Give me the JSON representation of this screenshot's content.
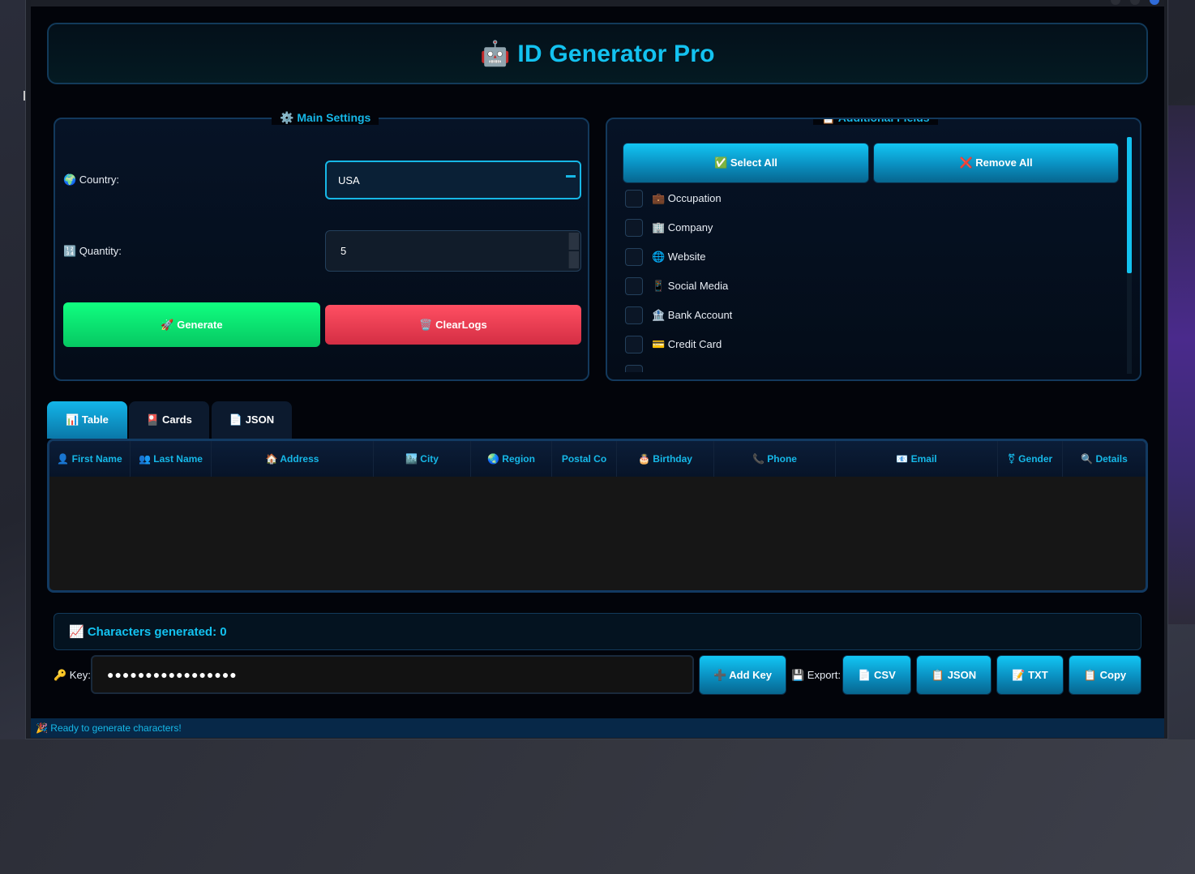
{
  "header": {
    "title": "🤖 ID Generator Pro"
  },
  "main_settings": {
    "legend": "⚙️ Main Settings",
    "country_label": "🌍 Country:",
    "country_value": "USA",
    "quantity_label": "🔢 Quantity:",
    "quantity_value": "5",
    "generate_label": "🚀 Generate",
    "clear_label": "🗑️ ClearLogs"
  },
  "additional_fields": {
    "legend": "📋 Additional Fields",
    "select_all_label": "✅ Select All",
    "remove_all_label": "❌ Remove All",
    "items": [
      {
        "label": "💼 Occupation",
        "checked": false
      },
      {
        "label": "🏢 Company",
        "checked": false
      },
      {
        "label": "🌐 Website",
        "checked": false
      },
      {
        "label": "📱 Social Media",
        "checked": false
      },
      {
        "label": "🏦 Bank Account",
        "checked": false
      },
      {
        "label": "💳 Credit Card",
        "checked": false
      }
    ]
  },
  "tabs": [
    {
      "label": "📊 Table",
      "active": true
    },
    {
      "label": "🎴 Cards",
      "active": false
    },
    {
      "label": "📄 JSON",
      "active": false
    }
  ],
  "table": {
    "columns": [
      "👤 First Name",
      "👥 Last Name",
      "🏠 Address",
      "🏙️ City",
      "🌏 Region",
      "Postal Co",
      "🎂 Birthday",
      "📞 Phone",
      "📧 Email",
      "⚧ Gender",
      "🔍 Details"
    ],
    "rows": []
  },
  "stats": {
    "text": "📈 Characters generated: 0"
  },
  "footer": {
    "key_label": "🔑 Key:",
    "key_value": "●●●●●●●●●●●●●●●●●",
    "add_key_label": "➕ Add Key",
    "export_label": "💾 Export:",
    "csv_label": "📄 CSV",
    "json_label": "📋 JSON",
    "txt_label": "📝 TXT",
    "copy_label": "📋 Copy"
  },
  "status_bar": {
    "text": "🎉 Ready to generate characters!"
  },
  "colors": {
    "accent": "#13c2f0",
    "generate": "#0ce870",
    "clear": "#ef4356",
    "background": "#02040a"
  }
}
